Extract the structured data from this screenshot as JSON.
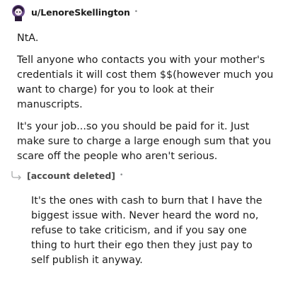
{
  "comment1": {
    "username": "u/LenoreSkellington",
    "separator": "•",
    "paragraphs": [
      "NtA.",
      "Tell anyone who contacts you with your mother's credentials it will cost them $$(however much you want to charge) for you to look at their manuscripts.",
      "It's your job...so you should be paid for it. Just make sure to charge a large enough sum that you scare off the people who aren't serious."
    ]
  },
  "comment2": {
    "username": "[account deleted]",
    "separator": "•",
    "paragraphs": [
      "It's the ones with cash to burn that I have the biggest issue with. Never heard the word no, refuse to take criticism, and if you say one thing to hurt their ego then they just pay to self publish it anyway."
    ]
  }
}
